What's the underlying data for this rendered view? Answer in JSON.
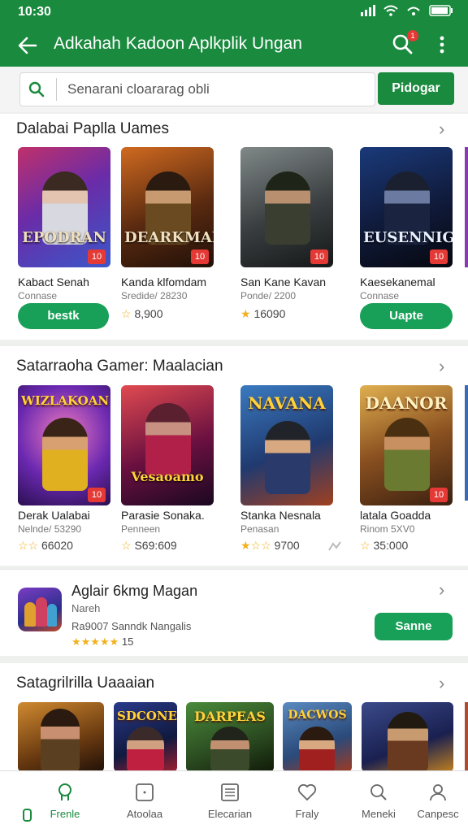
{
  "status": {
    "time": "10:30"
  },
  "appbar": {
    "title": "Adkahah Kadoon Aplkplik Ungan",
    "notif_count": "1"
  },
  "search": {
    "placeholder": "Senarani cloararag obli",
    "button": "Pidogar"
  },
  "section1": {
    "title": "Dalabai Paplla Uames",
    "cards": [
      {
        "cover_text": "EPODRAN",
        "badge": "10",
        "name": "Kabact Senah",
        "sub": "Connase",
        "action": "bestk"
      },
      {
        "cover_text": "DEARKMAN",
        "badge": "10",
        "name": "Kanda klfomdam",
        "sub": "Sredide/ 28230",
        "rating": "8,900"
      },
      {
        "cover_text": "",
        "badge": "10",
        "name": "San Kane Kavan",
        "sub": "Ponde/ 2200",
        "rating": "16090"
      },
      {
        "cover_text": "EUSENNIG",
        "badge": "10",
        "name": "Kaesekanemal",
        "sub": "Connase",
        "action": "Uapte"
      }
    ]
  },
  "section2": {
    "title": "Satarraoha Gamer: Maalacian",
    "cards": [
      {
        "cover_text": "WIZLAKOAN",
        "badge": "10",
        "name": "Derak Ualabai",
        "sub": "Nelnde/ 53290",
        "rating": "66020"
      },
      {
        "cover_text": "Vesaoamo",
        "badge": "",
        "name": "Parasie Sonaka.",
        "sub": "Penneen",
        "rating": "S69:609"
      },
      {
        "cover_text": "NAVANA",
        "badge": "",
        "name": "Stanka Nesnala",
        "sub": "Penasan",
        "rating": "9700"
      },
      {
        "cover_text": "DAANOR",
        "badge": "10",
        "name": "latala Goadda",
        "sub": "Rinom 5XV0",
        "rating": "35:000"
      }
    ]
  },
  "featured": {
    "title": "Aglair 6kmg Magan",
    "sub1": "Nareh",
    "sub2": "Ra9007 Sanndk Nangalis",
    "rating": "15",
    "button": "Sanne"
  },
  "section3": {
    "title": "Satagrilrilla Uaaaian",
    "cards": [
      {
        "cover_text": ""
      },
      {
        "cover_text": "SDCONE"
      },
      {
        "cover_text": "DARPEAS"
      },
      {
        "cover_text": "DACWOS"
      },
      {
        "cover_text": ""
      }
    ]
  },
  "nav": [
    {
      "label": "Frenle",
      "icon": "home-icon"
    },
    {
      "label": "Atoolaa",
      "icon": "apps-icon"
    },
    {
      "label": "Elecarian",
      "icon": "list-icon"
    },
    {
      "label": "Fraly",
      "icon": "heart-icon"
    },
    {
      "label": "Meneki",
      "icon": "search-icon"
    },
    {
      "label": "Canpesc",
      "icon": "profile-icon"
    }
  ],
  "colors": {
    "brand": "#1a8a3e",
    "button": "#18a058",
    "badge": "#e53935",
    "star": "#f2b01e"
  }
}
